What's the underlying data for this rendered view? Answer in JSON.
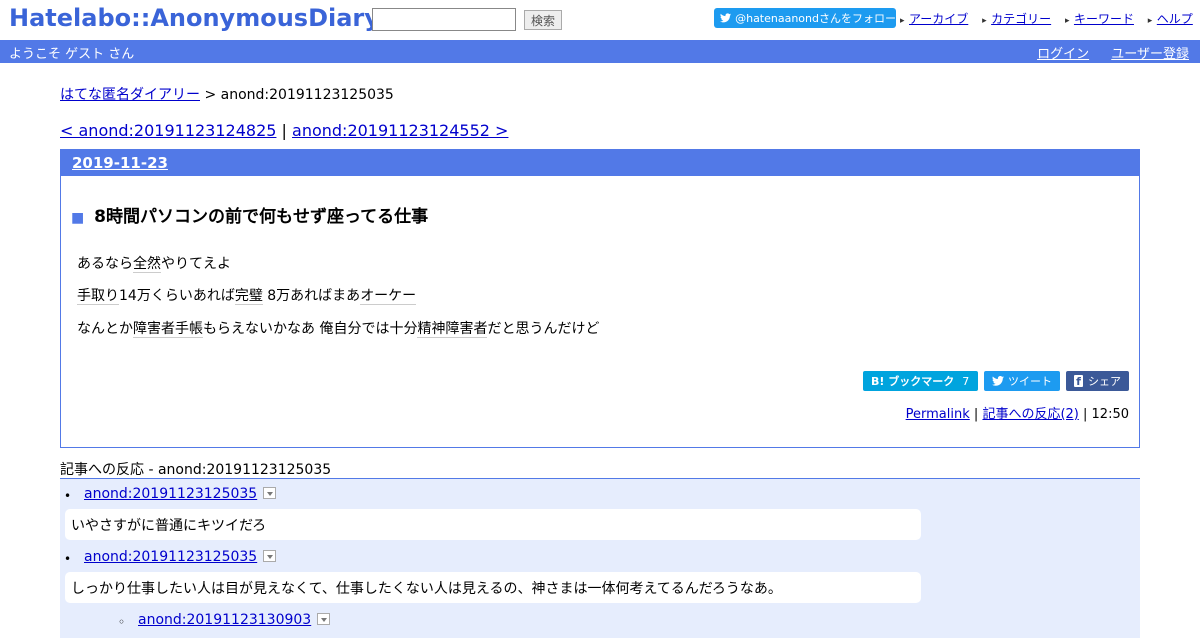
{
  "header": {
    "logo": "Hatelabo::AnonymousDiary",
    "search_placeholder": "",
    "search_button": "検索",
    "follow_button": "@hatenaanondさんをフォロー",
    "links": [
      "アーカイブ",
      "カテゴリー",
      "キーワード",
      "ヘルプ"
    ]
  },
  "bar": {
    "welcome": "ようこそ ゲスト さん",
    "login": "ログイン",
    "register": "ユーザー登録"
  },
  "breadcrumb": {
    "home": "はてな匿名ダイアリー",
    "current": "> anond:20191123125035"
  },
  "pager": {
    "prev": "< anond:20191123124825",
    "separator": "|",
    "next": "anond:20191123124552 >"
  },
  "entry": {
    "date": "2019-11-23",
    "title_marker": "■",
    "title": "8時間パソコンの前で何もせず座ってる仕事",
    "paragraphs": [
      [
        "あるなら",
        "全然",
        "やりてえよ"
      ],
      [
        "手取り",
        "14万くらいあれば",
        "完璧",
        " 8万あればまあ",
        "オーケー"
      ],
      [
        "なんとか",
        "障害者手帳",
        "もらえないかなあ 俺自分では十分",
        "精神障害者",
        "だと思うんだけど"
      ]
    ],
    "share": {
      "bookmark": "B! ブックマーク",
      "bookmark_count": "7",
      "tweet": "ツイート",
      "facebook": "シェア"
    },
    "meta": {
      "permalink": "Permalink",
      "sep1": "|",
      "reactions": "記事への反応(2)",
      "sep2": "|",
      "time": "12:50"
    }
  },
  "reactions": {
    "heading": "記事への反応 - anond:20191123125035",
    "items": [
      {
        "link": "anond:20191123125035",
        "text": "いやさすがに普通にキツイだろ"
      },
      {
        "link": "anond:20191123125035",
        "text": "しっかり仕事したい人は目が見えなくて、仕事したくない人は見えるの、神さまは一体何考えてるんだろうなあ。"
      },
      {
        "link": "anond:20191123130903",
        "text": ""
      }
    ]
  },
  "colors": {
    "accent": "#5279e7",
    "reaction_bg": "#e6edfd",
    "twitter": "#1d9bf0",
    "hatena": "#00a4de",
    "facebook": "#3b5998"
  }
}
